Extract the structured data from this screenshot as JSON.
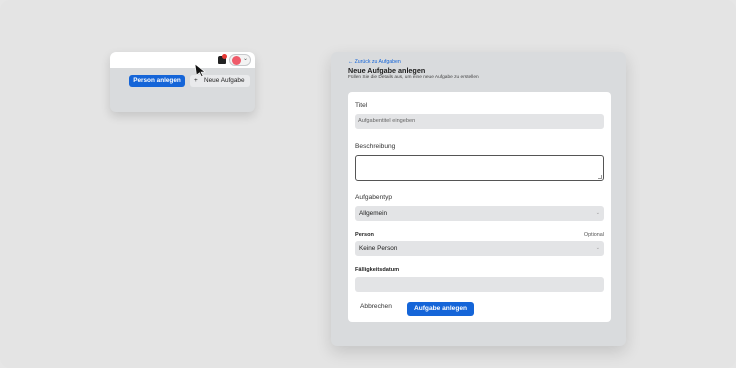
{
  "preview": {
    "primary_button": "Person anlegen",
    "secondary_button_icon": "plus-icon",
    "secondary_button_plus": "+",
    "secondary_button": "Neue Aufgabe",
    "avatar_caret": "⌄"
  },
  "form_page": {
    "back_link": "← Zurück zu Aufgaben",
    "title": "Neue Aufgabe anlegen",
    "subtitle": "Füllen Sie die Details aus, um eine neue Aufgabe zu erstellen",
    "fields": {
      "title_label": "Titel",
      "title_placeholder": "Aufgabentitel eingeben",
      "description_label": "Beschreibung",
      "type_label": "Aufgabentyp",
      "type_value": "Allgemein",
      "person_label": "Person",
      "person_optional": "Optional",
      "person_value": "Keine Person",
      "due_label": "Fälligkeitsdatum",
      "due_value": ""
    },
    "cancel_button": "Abbrechen",
    "submit_button": "Aufgabe anlegen",
    "select_caret": "⌄"
  },
  "colors": {
    "accent": "#1565d8",
    "notification_dot": "#e53935",
    "avatar": "#ef5b6a"
  }
}
